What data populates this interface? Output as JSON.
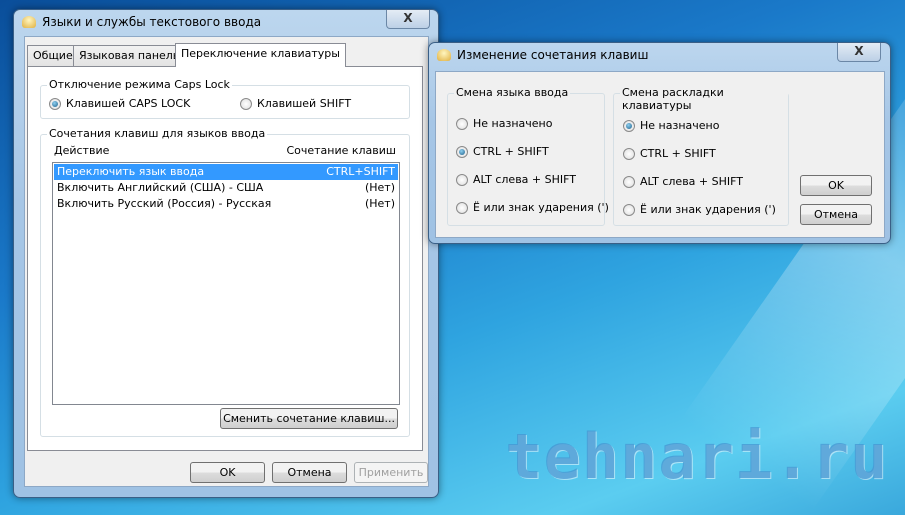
{
  "main_window": {
    "title": "Языки и службы текстового ввода",
    "close": "X",
    "tabs": [
      "Общие",
      "Языковая панель",
      "Переключение клавиатуры"
    ],
    "caps_group": {
      "label": "Отключение режима Caps Lock",
      "options": [
        {
          "label": "Клавишей CAPS LOCK",
          "checked": true
        },
        {
          "label": "Клавишей SHIFT",
          "checked": false
        }
      ]
    },
    "hotkeys_group": {
      "label": "Сочетания клавиш для языков ввода",
      "columns": [
        "Действие",
        "Сочетание клавиш"
      ],
      "rows": [
        {
          "action": "Переключить язык ввода",
          "keys": "CTRL+SHIFT",
          "selected": true
        },
        {
          "action": "Включить Английский (США) - США",
          "keys": "(Нет)",
          "selected": false
        },
        {
          "action": "Включить Русский (Россия) - Русская",
          "keys": "(Нет)",
          "selected": false
        }
      ],
      "change_button": "Сменить сочетание клавиш..."
    },
    "buttons": {
      "ok": "OK",
      "cancel": "Отмена",
      "apply": "Применить"
    }
  },
  "dialog": {
    "title": "Изменение сочетания клавиш",
    "close": "X",
    "input_lang_group": {
      "label": "Смена языка ввода",
      "options": [
        {
          "label": "Не назначено",
          "checked": false
        },
        {
          "label": "CTRL + SHIFT",
          "checked": true
        },
        {
          "label": "ALT слева + SHIFT",
          "checked": false
        },
        {
          "label": "Ё или знак ударения (')",
          "checked": false
        }
      ]
    },
    "layout_group": {
      "label": "Смена раскладки клавиатуры",
      "options": [
        {
          "label": "Не назначено",
          "checked": true
        },
        {
          "label": "CTRL + SHIFT",
          "checked": false
        },
        {
          "label": "ALT слева + SHIFT",
          "checked": false
        },
        {
          "label": "Ё или знак ударения (')",
          "checked": false
        }
      ]
    },
    "buttons": {
      "ok": "OK",
      "cancel": "Отмена"
    }
  },
  "watermark": "tehnari.ru"
}
